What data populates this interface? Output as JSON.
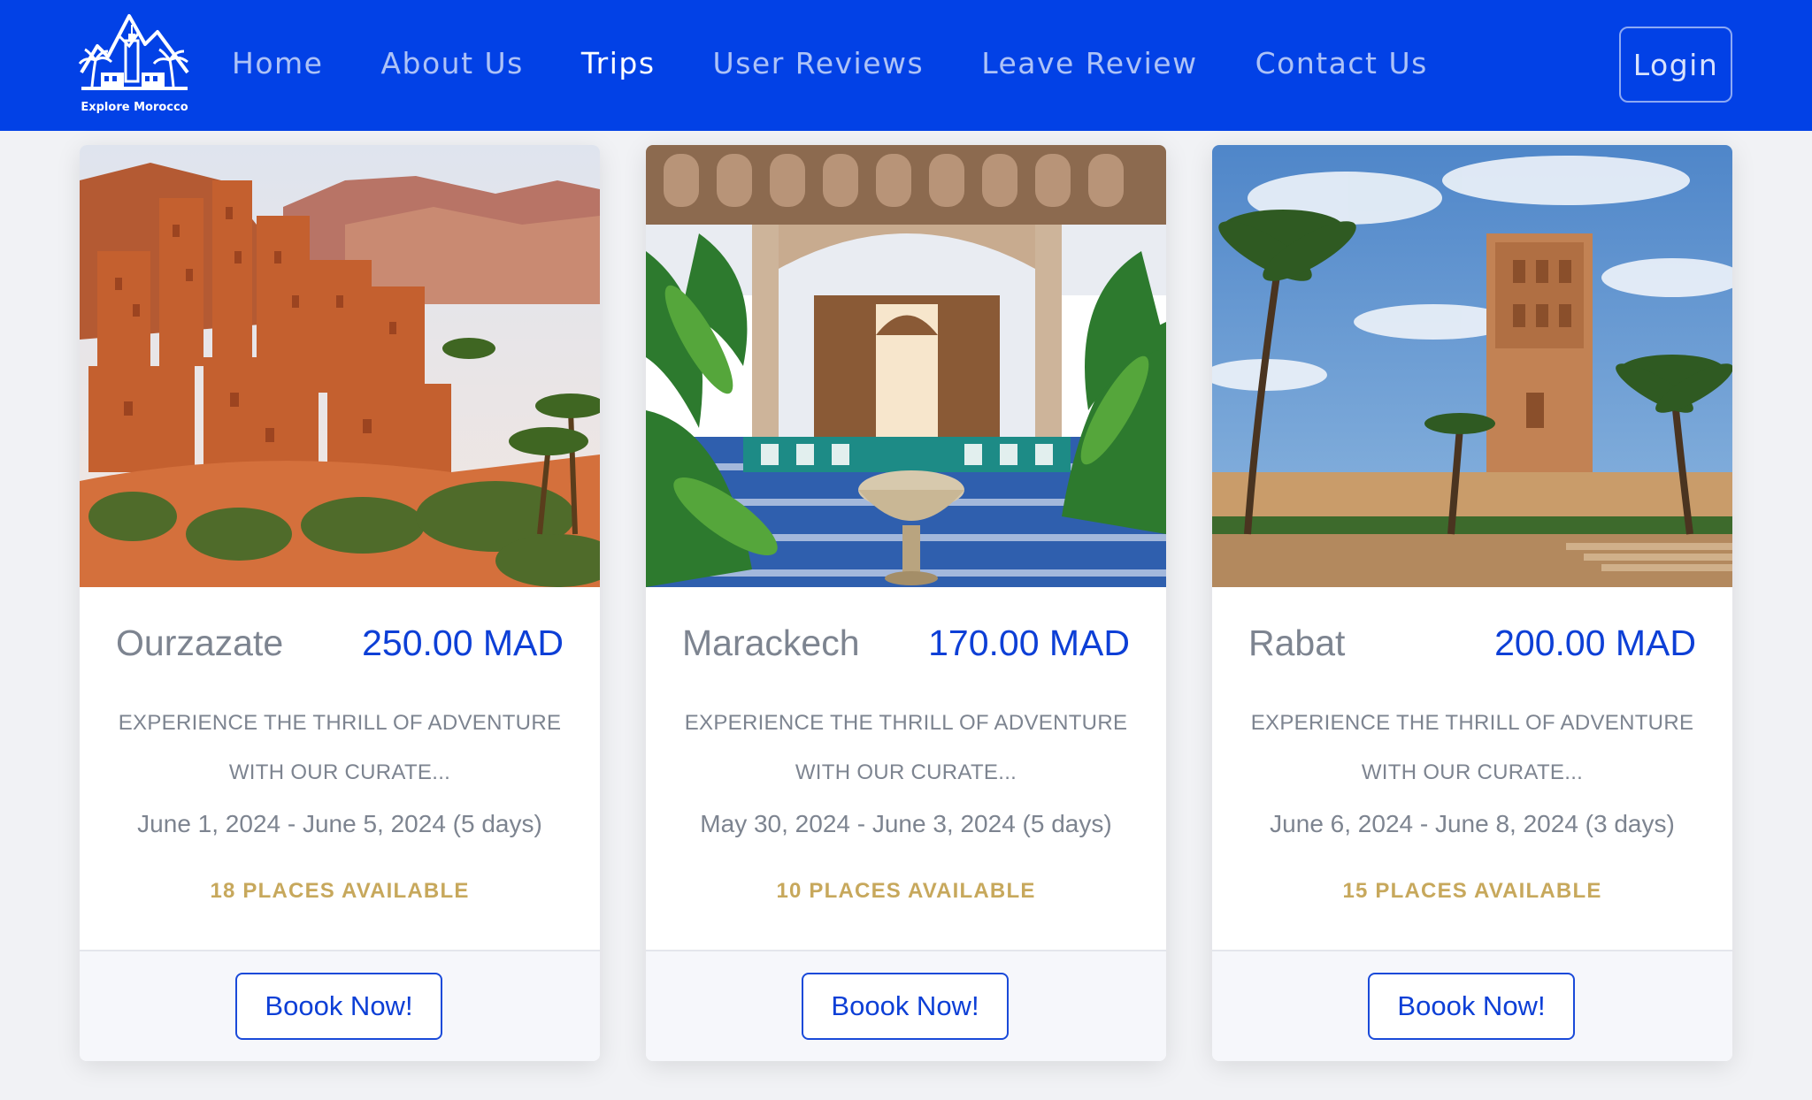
{
  "brand": {
    "logo_text": "Explore Morocco",
    "colors": {
      "navbar": "#0241e6",
      "price": "#0d3fd6",
      "places": "#c7a85c",
      "muted_text": "#7d8490"
    }
  },
  "nav": {
    "items": [
      {
        "label": "Home"
      },
      {
        "label": "About Us"
      },
      {
        "label": "Trips",
        "active": true
      },
      {
        "label": "User Reviews"
      },
      {
        "label": "Leave Review"
      },
      {
        "label": "Contact Us"
      }
    ],
    "login_label": "Login"
  },
  "trips": [
    {
      "city": "Ourzazate",
      "price": "250.00 MAD",
      "description": "EXPERIENCE THE THRILL OF ADVENTURE WITH OUR CURATE...",
      "dates": "June 1, 2024 - June 5, 2024 (5 days)",
      "places": "18 PLACES AVAILABLE",
      "button_label": "Boook Now!",
      "image": "kasbah-desert-photo"
    },
    {
      "city": "Marackech",
      "price": "170.00 MAD",
      "description": "EXPERIENCE THE THRILL OF ADVENTURE WITH OUR CURATE...",
      "dates": "May 30, 2024 - June 3, 2024 (5 days)",
      "places": "10 PLACES AVAILABLE",
      "button_label": "Boook Now!",
      "image": "riad-courtyard-photo"
    },
    {
      "city": "Rabat",
      "price": "200.00 MAD",
      "description": "EXPERIENCE THE THRILL OF ADVENTURE WITH OUR CURATE...",
      "dates": "June 6, 2024 - June 8, 2024 (3 days)",
      "places": "15 PLACES AVAILABLE",
      "button_label": "Boook Now!",
      "image": "hassan-tower-photo"
    }
  ]
}
